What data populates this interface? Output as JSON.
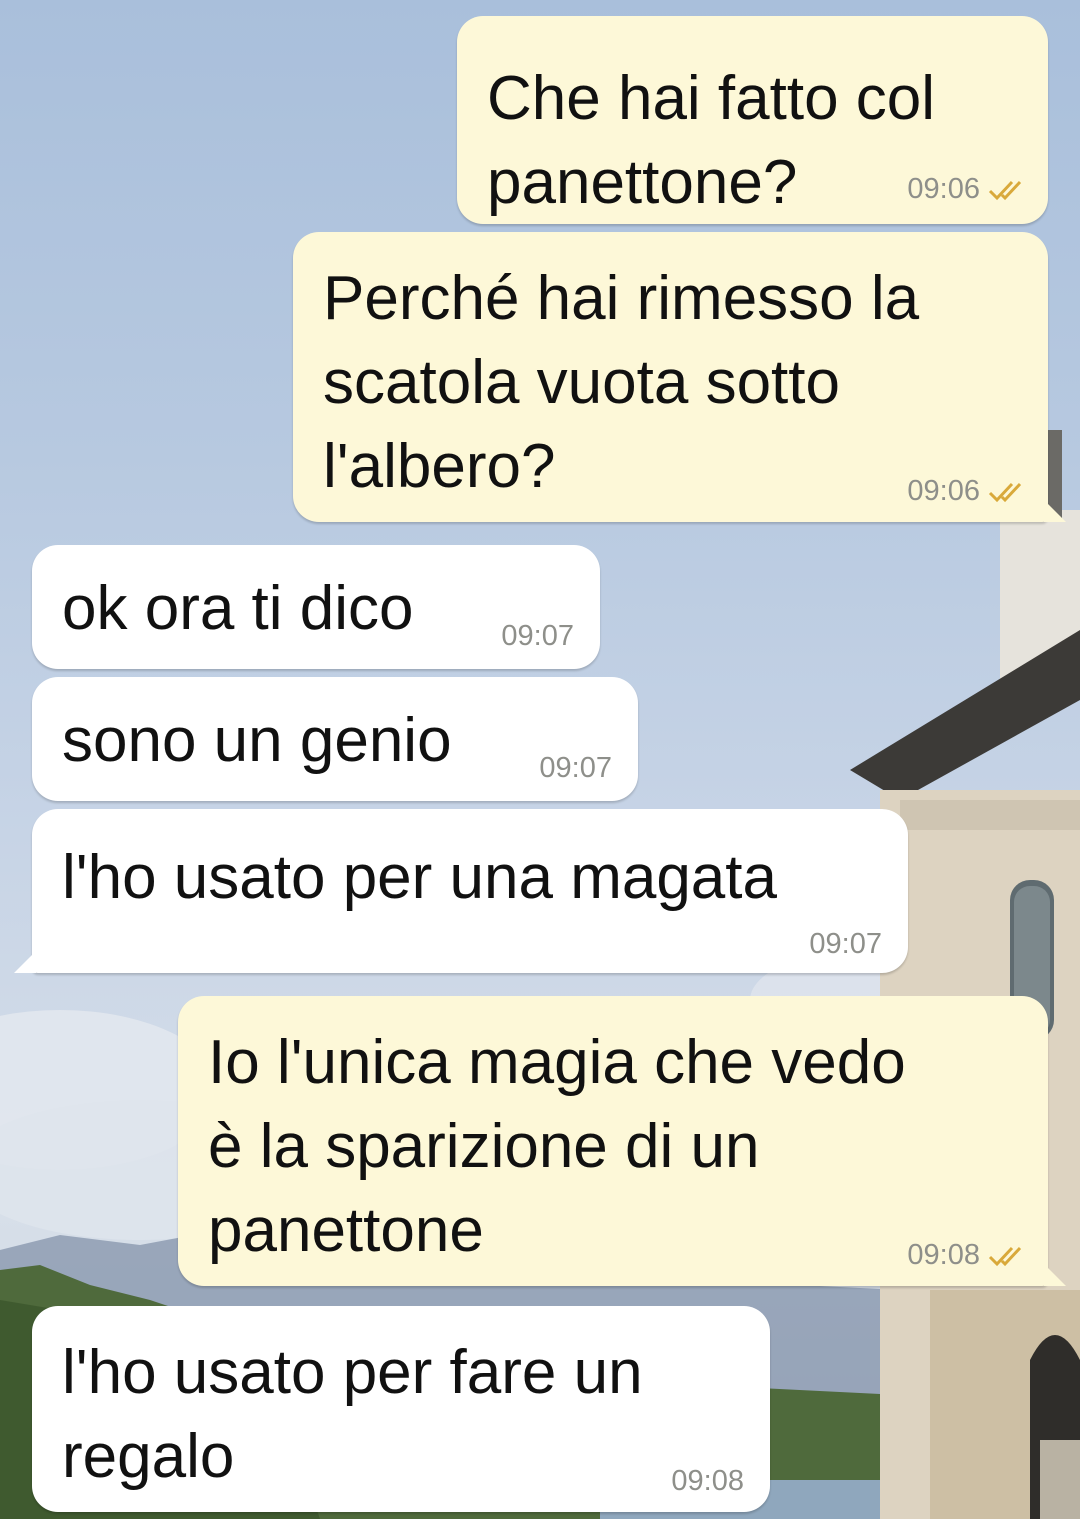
{
  "colors": {
    "outgoing_bubble": "#fdf8d8",
    "incoming_bubble": "#ffffff",
    "timestamp": "#8e8f8a",
    "read_ticks": "#d9a93a"
  },
  "messages": [
    {
      "direction": "outgoing",
      "lines": [
        "Che hai fatto col",
        "panettone?"
      ],
      "time": "09:06",
      "status_icon": "double-check-icon"
    },
    {
      "direction": "outgoing",
      "lines": [
        "Perché hai rimesso la",
        "scatola vuota sotto",
        "l'albero?"
      ],
      "time": "09:06",
      "status_icon": "double-check-icon"
    },
    {
      "direction": "incoming",
      "lines": [
        "ok ora ti dico"
      ],
      "time": "09:07"
    },
    {
      "direction": "incoming",
      "lines": [
        "sono un genio"
      ],
      "time": "09:07"
    },
    {
      "direction": "incoming",
      "lines": [
        "l'ho usato per una magata"
      ],
      "time": "09:07"
    },
    {
      "direction": "outgoing",
      "lines": [
        "Io l'unica magia che vedo",
        "è la sparizione di un",
        "panettone"
      ],
      "time": "09:08",
      "status_icon": "double-check-icon"
    },
    {
      "direction": "incoming",
      "lines": [
        "l'ho usato per fare un",
        "regalo"
      ],
      "time": "09:08"
    }
  ]
}
